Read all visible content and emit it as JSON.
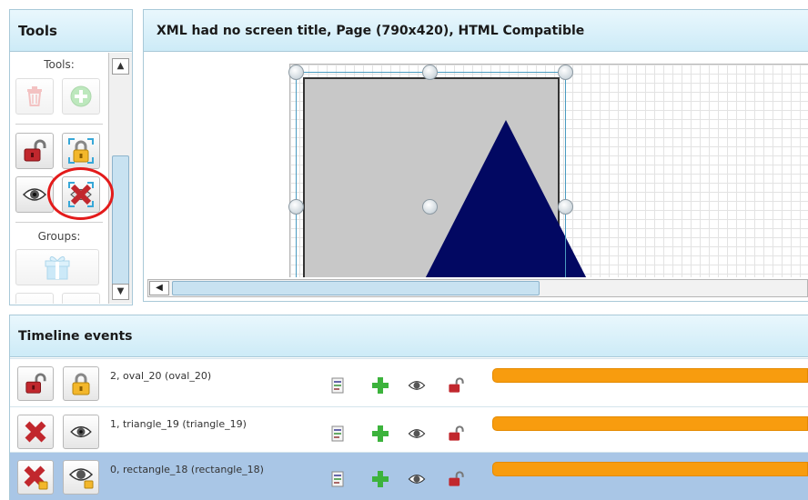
{
  "tools_panel": {
    "title": "Tools",
    "section_tools": "Tools:",
    "section_groups": "Groups:",
    "buttons": [
      {
        "icon": "trash-icon",
        "state": "disabled"
      },
      {
        "icon": "add-circle-icon",
        "state": "disabled"
      },
      {
        "icon": "unlock-icon",
        "state": "enabled"
      },
      {
        "icon": "lock-selection-icon",
        "state": "enabled"
      },
      {
        "icon": "eye-icon",
        "state": "enabled"
      },
      {
        "icon": "hide-selection-icon",
        "state": "enabled"
      },
      {
        "icon": "group-gift-icon",
        "state": "disabled"
      }
    ]
  },
  "canvas_panel": {
    "title": "XML had no screen title, Page (790x420), HTML Compatible",
    "shapes": [
      {
        "type": "rectangle",
        "fill": "#c8c8c8"
      },
      {
        "type": "triangle",
        "fill": "#020862"
      }
    ]
  },
  "timeline": {
    "title": "Timeline events",
    "rows": [
      {
        "label": "2, oval_20 (oval_20)",
        "left_icons": [
          "unlock-icon",
          "lock-icon"
        ],
        "selected": false,
        "bar_color": "#f89c0e"
      },
      {
        "label": "1, triangle_19 (triangle_19)",
        "left_icons": [
          "delete-x-icon",
          "eye-icon"
        ],
        "selected": false,
        "bar_color": "#f89c0e"
      },
      {
        "label": "0, rectangle_18 (rectangle_18)",
        "left_icons": [
          "delete-x-locked-icon",
          "eye-locked-icon"
        ],
        "selected": true,
        "bar_color": "#f89c0e"
      }
    ],
    "row_icons": [
      "properties-icon",
      "add-plus-icon",
      "eye-icon",
      "unlock-icon"
    ]
  },
  "colors": {
    "accent": "#cdebf7",
    "highlight": "#e31b1b",
    "selected_row": "#a9c6e6",
    "shape_triangle": "#020862",
    "timeline_bar": "#f89c0e"
  }
}
